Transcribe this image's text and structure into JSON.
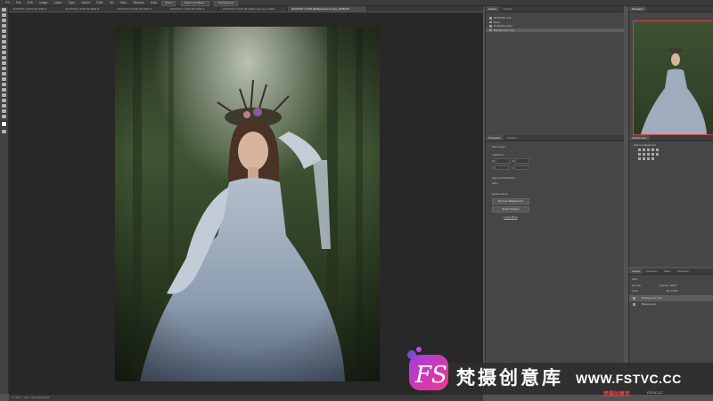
{
  "menubar": {
    "items": [
      "PS",
      "File",
      "Edit",
      "Image",
      "Layer",
      "Type",
      "Select",
      "Filter",
      "3D",
      "View",
      "Window",
      "Help"
    ],
    "buttons": [
      "Select",
      "Select and Mask...",
      "Transparency"
    ]
  },
  "tabs": [
    {
      "label": "20170707-1-8-55-35-4000.tif",
      "active": false
    },
    {
      "label": "20170707-2-8-55-35-4000.tif",
      "active": false
    },
    {
      "label": "20170707-3-8-55-35-4000.tif",
      "active": false
    },
    {
      "label": "20170707-4-8-55-35-4000.tif",
      "active": false
    },
    {
      "label": "20170707-5-8-55-35-4000.tif @ Layer Mask",
      "active": false
    },
    {
      "label": "20170707-7-8-55-35-Background copy, RGB/16*",
      "active": true
    }
  ],
  "history_panel": {
    "tabs": [
      "History",
      "Actions"
    ],
    "items": [
      {
        "label": "20170707-4.tif",
        "selected": false
      },
      {
        "label": "Open",
        "selected": false
      },
      {
        "label": "Duplicate Layer",
        "selected": false
      },
      {
        "label": "Background copy",
        "selected": true
      }
    ]
  },
  "navigator": {
    "title": "Navigator",
    "zoom": "17.42%"
  },
  "properties": {
    "tabs": [
      "Properties",
      "Libraries"
    ],
    "layer_kind": "Pixel Layer",
    "transform_title": "Transform",
    "fields": [
      {
        "label": "W",
        "value": "4000 px"
      },
      {
        "label": "H",
        "value": "5333 px"
      },
      {
        "label": "X",
        "value": "0 px"
      },
      {
        "label": "Y",
        "value": "0 px"
      }
    ],
    "align_title": "Align and Distribute",
    "align_sub": "Align:",
    "quick_actions_title": "Quick Actions",
    "btn_remove": "Remove Background",
    "btn_select": "Select Subject",
    "learn_more": "Learn More"
  },
  "adjustments": {
    "title": "Adjustments",
    "subtitle": "Add an adjustment"
  },
  "layers": {
    "tabs": [
      "Layers",
      "Channels",
      "Paths",
      "Swatches"
    ],
    "kind": "Kind",
    "blend": "Normal",
    "opacity": "Opacity: 100%",
    "lock": "Lock:",
    "fill": "Fill: 100%",
    "items": [
      {
        "name": "Background copy",
        "selected": true
      },
      {
        "name": "Background",
        "selected": false
      }
    ]
  },
  "statusbar": {
    "zoom": "17.42%",
    "doc": "Doc: 122.1M/244.1M"
  },
  "watermark": {
    "brand": "梵摄创意库",
    "url": "WWW.FSTVC.CC",
    "corner": "梵摄创意库",
    "corner_url": "FSTVC.CC"
  },
  "colors": {
    "logo_gradient_start": "#a13ce0",
    "logo_gradient_end": "#f03a8c"
  }
}
